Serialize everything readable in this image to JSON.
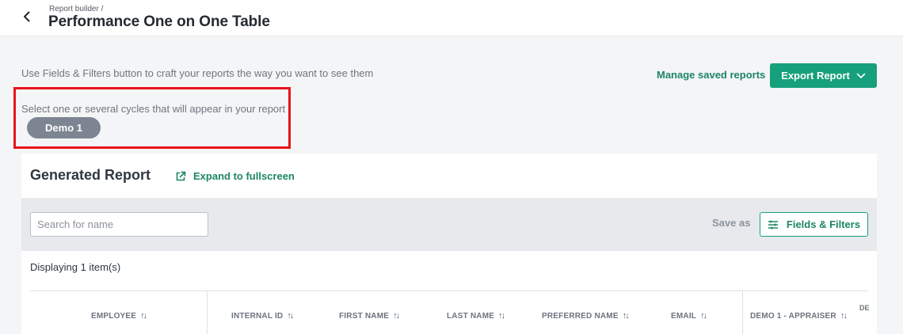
{
  "header": {
    "breadcrumb": "Report builder /",
    "title": "Performance One on One Table",
    "back_icon": "chevron-left-icon"
  },
  "intro": {
    "hint": "Use Fields & Filters button to craft your reports the way you want to see them",
    "manage_link": "Manage saved reports",
    "export_label": "Export Report",
    "export_icon": "chevron-down-icon"
  },
  "cycles": {
    "label": "Select one or several cycles that will appear in your report",
    "selected": [
      "Demo 1"
    ],
    "highlight_color": "#e8141a"
  },
  "report": {
    "title": "Generated Report",
    "expand_label": "Expand to fullscreen",
    "expand_icon": "external-link-icon",
    "search_placeholder": "Search for name",
    "save_as": "Save as",
    "fields_label": "Fields & Filters",
    "fields_icon": "sliders-icon",
    "count_text": "Displaying 1 item(s)",
    "columns": [
      "EMPLOYEE",
      "INTERNAL ID",
      "FIRST NAME",
      "LAST NAME",
      "PREFERRED NAME",
      "EMAIL",
      "DEMO 1 - APPRAISER",
      "DE"
    ],
    "sort_icon": "sort-arrows-icon"
  },
  "colors": {
    "accent": "#17a07c",
    "accent_text": "#1c8567",
    "chip": "#7d8592"
  }
}
